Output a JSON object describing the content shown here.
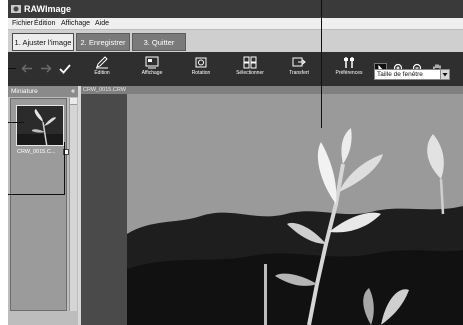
{
  "app": {
    "title": "RAWImage"
  },
  "menu": {
    "items": [
      "Fichier",
      "Édition",
      "Affichage",
      "Aide"
    ]
  },
  "tabs": [
    {
      "label": "1. Ajuster l'image",
      "active": true
    },
    {
      "label": "2. Enregistrer",
      "active": false
    },
    {
      "label": "3. Quitter",
      "active": false
    }
  ],
  "toolbar": {
    "buttons": [
      {
        "label": "Édition",
        "icon": "edit-icon"
      },
      {
        "label": "Affichage",
        "icon": "display-icon"
      },
      {
        "label": "Rotation",
        "icon": "rotate-icon"
      },
      {
        "label": "Sélectionner",
        "icon": "select-icon"
      },
      {
        "label": "Transfert",
        "icon": "transfer-icon"
      },
      {
        "label": "Préférences",
        "icon": "preferences-icon"
      }
    ],
    "zoom_value": "Taille de fenêtre"
  },
  "sidebar": {
    "title": "Miniature",
    "thumbnail_caption": "CRW_0015.C..."
  },
  "viewer": {
    "filename": "CRW_0015.CRW"
  }
}
